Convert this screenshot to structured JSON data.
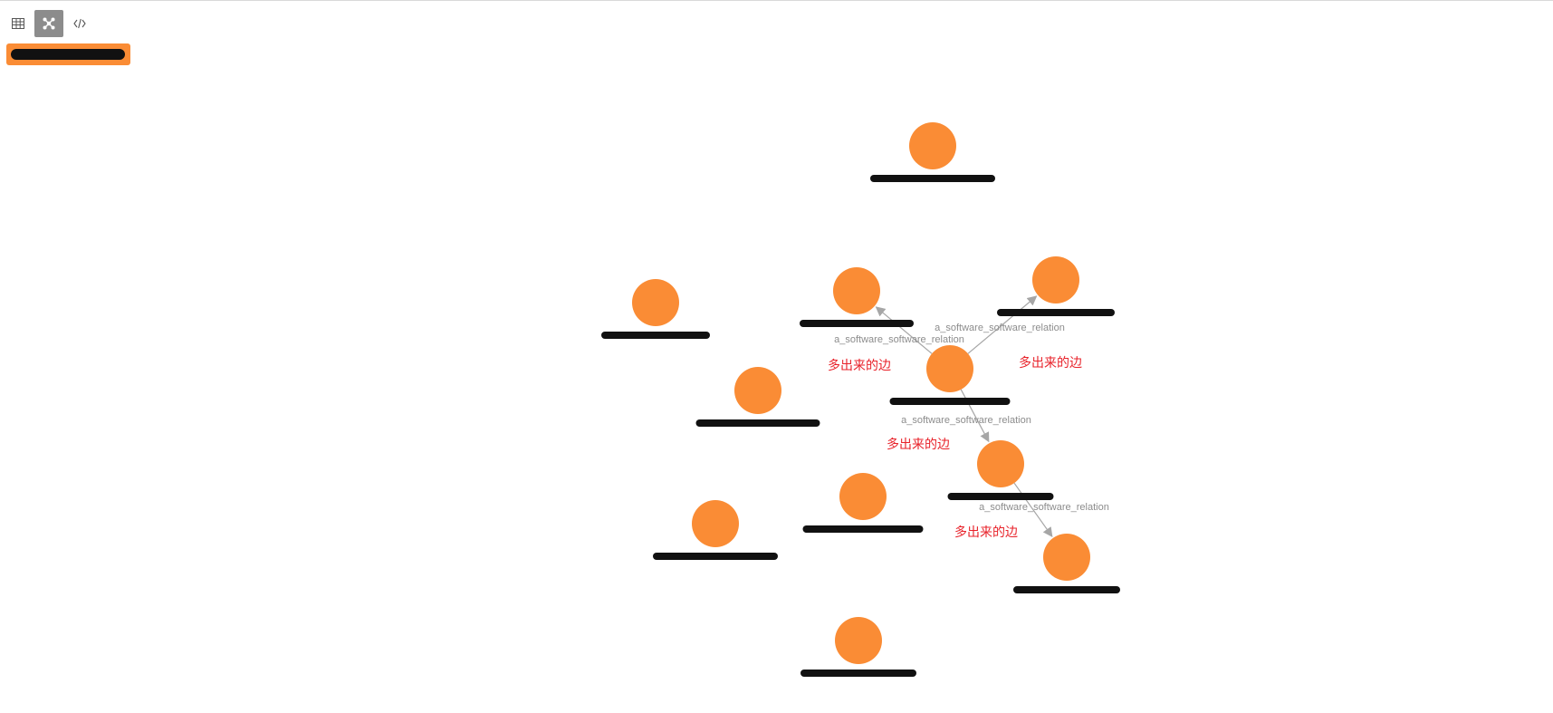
{
  "toolbar": {
    "buttons": [
      {
        "name": "table-view-button",
        "icon": "table-icon",
        "active": false
      },
      {
        "name": "graph-view-button",
        "icon": "graph-icon",
        "active": true
      },
      {
        "name": "code-view-button",
        "icon": "code-icon",
        "active": false
      }
    ]
  },
  "legend": {
    "label": "",
    "color": "#fa8c35"
  },
  "colors": {
    "node": "#fa8c35",
    "edge": "#a6a6a6",
    "edge_label": "#8c8c8c",
    "annotation": "#e8222a",
    "redaction": "#111111"
  },
  "graph": {
    "nodes": [
      {
        "id": "n0",
        "label": "",
        "redacted": true
      },
      {
        "id": "n1",
        "label": "",
        "redacted": true
      },
      {
        "id": "n2",
        "label": "",
        "redacted": true
      },
      {
        "id": "n3",
        "label": "",
        "redacted": true
      },
      {
        "id": "n4",
        "label": "",
        "redacted": true
      },
      {
        "id": "n5",
        "label": "",
        "redacted": true
      },
      {
        "id": "n6",
        "label": "",
        "redacted": true
      },
      {
        "id": "n7",
        "label": "",
        "redacted": true
      },
      {
        "id": "n8",
        "label": "",
        "redacted": true
      },
      {
        "id": "n9",
        "label": "",
        "redacted": true
      },
      {
        "id": "n10",
        "label": "",
        "redacted": true
      }
    ],
    "edges": [
      {
        "from": "n5",
        "to": "n2",
        "label": "a_software_software_relation"
      },
      {
        "from": "n5",
        "to": "n3",
        "label": "a_software_software_relation"
      },
      {
        "from": "n5",
        "to": "n7",
        "label": "a_software_software_relation"
      },
      {
        "from": "n7",
        "to": "n9",
        "label": "a_software_software_relation"
      }
    ],
    "annotations": [
      {
        "text": "多出来的边"
      },
      {
        "text": "多出来的边"
      },
      {
        "text": "多出来的边"
      },
      {
        "text": "多出来的边"
      }
    ]
  }
}
